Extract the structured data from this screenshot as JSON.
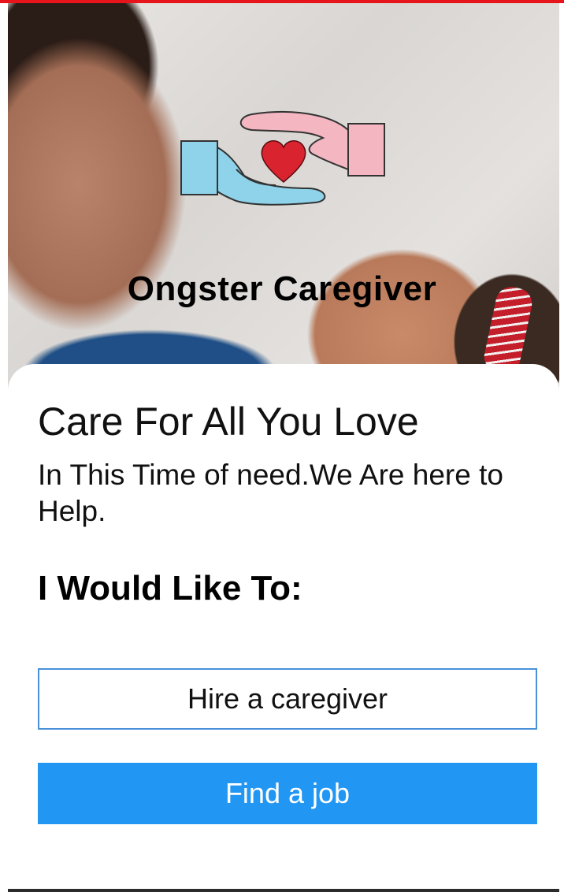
{
  "hero": {
    "brand_name": "Ongster Caregiver",
    "image": "photo-mother-and-child",
    "logo": "caring-hands-heart-icon"
  },
  "main": {
    "headline": "Care For All You Love",
    "subtext": "In This Time of need.We Are here to Help.",
    "prompt": "I Would Like To:"
  },
  "actions": {
    "hire_label": "Hire a caregiver",
    "job_label": "Find a job"
  },
  "colors": {
    "accent_top": "#e8141b",
    "primary": "#2196f3",
    "outline": "#4a90d9",
    "logo_blue": "#8fd3ea",
    "logo_pink": "#f4b6c0",
    "heart": "#d9242f"
  }
}
